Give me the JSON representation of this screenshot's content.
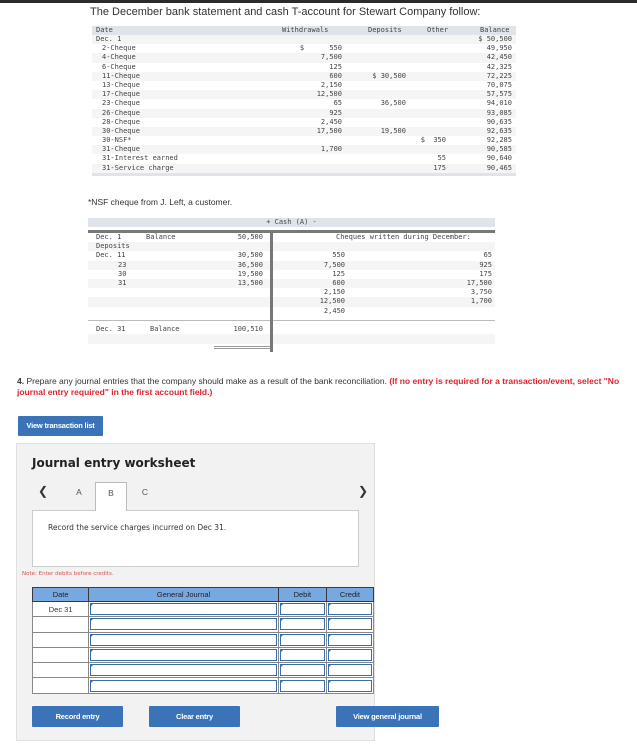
{
  "intro_text": "The December bank statement and cash T-account for Stewart Company follow:",
  "bank_statement": {
    "headers": {
      "date": "Date",
      "withdrawals": "Withdrawals",
      "deposits": "Deposits",
      "other": "Other",
      "balance": "Balance"
    },
    "rows": [
      {
        "date": "Dec. 1",
        "withdrawals": "",
        "deposits": "",
        "other": "",
        "balance": "$ 50,500"
      },
      {
        "date": "2-Cheque",
        "withdrawals": "$      550",
        "deposits": "",
        "other": "",
        "balance": "49,950"
      },
      {
        "date": "4-Cheque",
        "withdrawals": "7,500",
        "deposits": "",
        "other": "",
        "balance": "42,450"
      },
      {
        "date": "6-Cheque",
        "withdrawals": "125",
        "deposits": "",
        "other": "",
        "balance": "42,325"
      },
      {
        "date": "11-Cheque",
        "withdrawals": "600",
        "deposits": "$ 30,500",
        "other": "",
        "balance": "72,225"
      },
      {
        "date": "13-Cheque",
        "withdrawals": "2,150",
        "deposits": "",
        "other": "",
        "balance": "70,075"
      },
      {
        "date": "17-Cheque",
        "withdrawals": "12,500",
        "deposits": "",
        "other": "",
        "balance": "57,575"
      },
      {
        "date": "23-Cheque",
        "withdrawals": "65",
        "deposits": "36,500",
        "other": "",
        "balance": "94,010"
      },
      {
        "date": "26-Cheque",
        "withdrawals": "925",
        "deposits": "",
        "other": "",
        "balance": "93,085"
      },
      {
        "date": "28-Cheque",
        "withdrawals": "2,450",
        "deposits": "",
        "other": "",
        "balance": "90,635"
      },
      {
        "date": "30-Cheque",
        "withdrawals": "17,500",
        "deposits": "19,500",
        "other": "",
        "balance": "92,635"
      },
      {
        "date": "30-NSF*",
        "withdrawals": "",
        "deposits": "",
        "other": "$  350",
        "balance": "92,285"
      },
      {
        "date": "31-Cheque",
        "withdrawals": "1,700",
        "deposits": "",
        "other": "",
        "balance": "90,585"
      },
      {
        "date": "31-Interest earned",
        "withdrawals": "",
        "deposits": "",
        "other": "55",
        "balance": "90,640"
      },
      {
        "date": "31-Service charge",
        "withdrawals": "",
        "deposits": "",
        "other": "175",
        "balance": "90,465"
      }
    ]
  },
  "nsf_note": "*NSF cheque from J. Left, a customer.",
  "t_account": {
    "title": "+ Cash (A) -",
    "opening": {
      "date": "Dec. 1",
      "label": "Balance",
      "amount": "50,500"
    },
    "right_label": "Cheques written during December:",
    "deposits_label": "Deposits",
    "deposits": [
      {
        "date": "Dec. 11",
        "amount": "30,500"
      },
      {
        "date": "23",
        "amount": "36,500"
      },
      {
        "date": "30",
        "amount": "19,500"
      },
      {
        "date": "31",
        "amount": "13,500"
      }
    ],
    "cheques_col1": [
      "550",
      "7,500",
      "125",
      "600",
      "2,150",
      "12,500",
      "2,450"
    ],
    "cheques_col2": [
      "65",
      "925",
      "175",
      "17,500",
      "3,750",
      "1,700"
    ],
    "closing": {
      "date": "Dec. 31",
      "label": "Balance",
      "amount": "100,510"
    }
  },
  "question": {
    "number": "4.",
    "text": " Prepare any journal entries that the company should make as a result of the bank reconciliation. ",
    "instruction": "(If no entry is required for a transaction/event, select \"No journal entry required\" in the first account field.)"
  },
  "buttons": {
    "view_transaction_list": "View transaction list",
    "record_entry": "Record entry",
    "clear_entry": "Clear entry",
    "view_general_journal": "View general journal"
  },
  "worksheet": {
    "title": "Journal entry worksheet",
    "tabs": [
      "A",
      "B",
      "C"
    ],
    "active_tab": "B",
    "description": "Record the service charges incurred on Dec 31.",
    "note": "Note: Enter debits before credits.",
    "table": {
      "headers": {
        "date": "Date",
        "general_journal": "General Journal",
        "debit": "Debit",
        "credit": "Credit"
      },
      "rows": [
        {
          "date": "Dec 31",
          "account": "",
          "debit": "",
          "credit": ""
        },
        {
          "date": "",
          "account": "",
          "debit": "",
          "credit": ""
        },
        {
          "date": "",
          "account": "",
          "debit": "",
          "credit": ""
        },
        {
          "date": "",
          "account": "",
          "debit": "",
          "credit": ""
        },
        {
          "date": "",
          "account": "",
          "debit": "",
          "credit": ""
        },
        {
          "date": "",
          "account": "",
          "debit": "",
          "credit": ""
        }
      ]
    }
  },
  "colors": {
    "button_blue": "#3a73b8",
    "table_header_blue": "#77a8e0",
    "instruction_red": "#e0212b"
  }
}
